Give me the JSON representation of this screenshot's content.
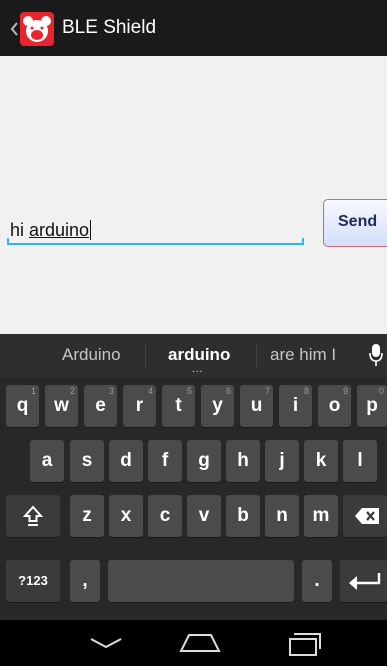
{
  "app": {
    "title": "BLE Shield"
  },
  "message": {
    "text_plain": "hi ",
    "text_composing": "arduino"
  },
  "send_label": "Send",
  "keyboard": {
    "suggestions": [
      "Arduino",
      "arduino",
      "are him I"
    ],
    "more_indicator": "...",
    "row1": [
      {
        "label": "q",
        "hint": "1"
      },
      {
        "label": "w",
        "hint": "2"
      },
      {
        "label": "e",
        "hint": "3"
      },
      {
        "label": "r",
        "hint": "4"
      },
      {
        "label": "t",
        "hint": "5"
      },
      {
        "label": "y",
        "hint": "6"
      },
      {
        "label": "u",
        "hint": "7"
      },
      {
        "label": "i",
        "hint": "8"
      },
      {
        "label": "o",
        "hint": "9"
      },
      {
        "label": "p",
        "hint": "0"
      }
    ],
    "row2": [
      "a",
      "s",
      "d",
      "f",
      "g",
      "h",
      "j",
      "k",
      "l"
    ],
    "row3": [
      "z",
      "x",
      "c",
      "v",
      "b",
      "n",
      "m"
    ],
    "symbols_label": "?123",
    "comma": ",",
    "period": "."
  },
  "colors": {
    "accent": "#33b5e5",
    "actionbar": "#1a1a1a",
    "logo_red": "#e8252f"
  },
  "icons": [
    "back-chevron-icon",
    "bear-logo-icon",
    "mic-icon",
    "shift-icon",
    "backspace-icon",
    "enter-icon",
    "nav-back-icon",
    "nav-home-icon",
    "nav-recents-icon"
  ]
}
